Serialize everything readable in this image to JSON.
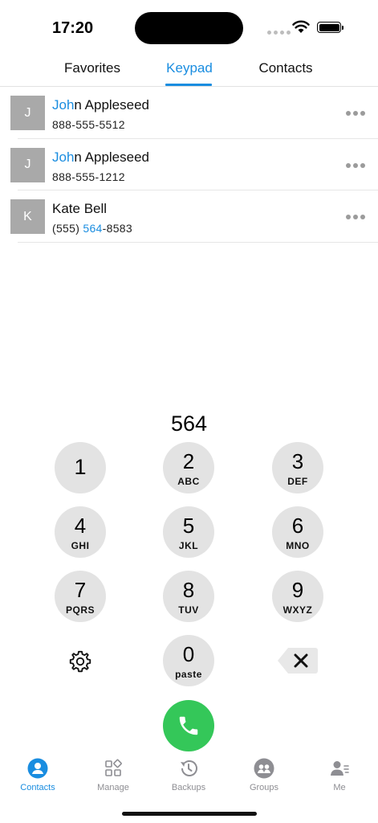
{
  "status_bar": {
    "time": "17:20"
  },
  "top_tabs": [
    {
      "label": "Favorites",
      "active": false
    },
    {
      "label": "Keypad",
      "active": true
    },
    {
      "label": "Contacts",
      "active": false
    }
  ],
  "contacts": [
    {
      "initial": "J",
      "name_match": "Joh",
      "name_rest": "n Appleseed",
      "phone_pre": "",
      "phone_match": "",
      "phone_post": "888-555-5512"
    },
    {
      "initial": "J",
      "name_match": "Joh",
      "name_rest": "n Appleseed",
      "phone_pre": "",
      "phone_match": "",
      "phone_post": "888-555-1212"
    },
    {
      "initial": "K",
      "name_match": "",
      "name_rest": "Kate Bell",
      "phone_pre": "(555) ",
      "phone_match": "564",
      "phone_post": "-8583"
    }
  ],
  "dialed_number": "564",
  "keypad": [
    {
      "digit": "1",
      "letters": ""
    },
    {
      "digit": "2",
      "letters": "ABC"
    },
    {
      "digit": "3",
      "letters": "DEF"
    },
    {
      "digit": "4",
      "letters": "GHI"
    },
    {
      "digit": "5",
      "letters": "JKL"
    },
    {
      "digit": "6",
      "letters": "MNO"
    },
    {
      "digit": "7",
      "letters": "PQRS"
    },
    {
      "digit": "8",
      "letters": "TUV"
    },
    {
      "digit": "9",
      "letters": "WXYZ"
    },
    {
      "digit": "0",
      "letters": "paste"
    }
  ],
  "icons": {
    "settings": "gear-icon",
    "delete": "backspace-icon",
    "call": "phone-icon",
    "more": "more-horizontal-icon"
  },
  "bottom_nav": [
    {
      "label": "Contacts",
      "icon": "contacts-icon",
      "active": true
    },
    {
      "label": "Manage",
      "icon": "manage-grid-icon",
      "active": false
    },
    {
      "label": "Backups",
      "icon": "history-icon",
      "active": false
    },
    {
      "label": "Groups",
      "icon": "groups-icon",
      "active": false
    },
    {
      "label": "Me",
      "icon": "me-icon",
      "active": false
    }
  ],
  "colors": {
    "accent": "#1a8de0",
    "call_green": "#34c759",
    "key_background": "#e3e3e3",
    "avatar_gray": "#a9a9a9"
  }
}
